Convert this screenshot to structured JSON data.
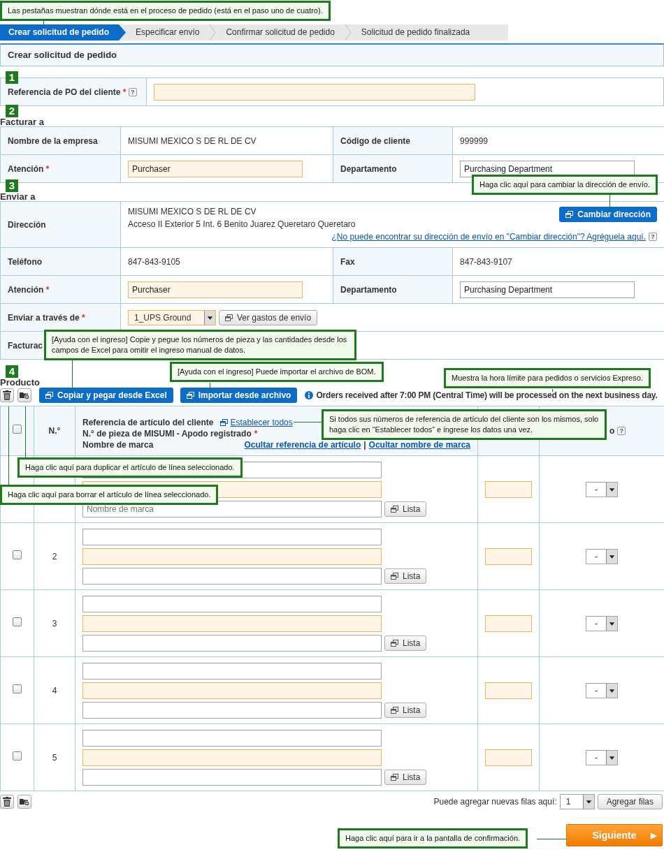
{
  "callouts": [
    {
      "text": "Las pestañas muestran dónde está en el proceso de pedido (está en el paso uno de cuatro)."
    },
    {
      "text": "Haga clic aquí para cambiar la dirección de envío."
    },
    {
      "text": "[Ayuda con el ingreso] Copie y pegue los números de pieza y las cantidades desde los campos de Excel para omitir el ingreso manual de datos."
    },
    {
      "text": "[Ayuda con el ingreso] Puede importar el archivo de BOM."
    },
    {
      "text": "Muestra la hora límite para pedidos o servicios Expreso."
    },
    {
      "text": "Si todos sus números de referencia de artículo del cliente son los mismos, solo haga clic en “Establecer todos” e ingrese los datos una vez."
    },
    {
      "text": "Haga clic aquí para duplicar el artículo de línea seleccionado."
    },
    {
      "text": "Haga clic aquí para borrar el artículo de línea seleccionado."
    },
    {
      "text": "Haga clic aquí para ir a la pantalla de confirmación."
    }
  ],
  "steps": [
    {
      "label": "Crear solicitud de pedido",
      "selected": true
    },
    {
      "label": "Especificar envío",
      "selected": false
    },
    {
      "label": "Confirmar solicitud de pedido",
      "selected": false
    },
    {
      "label": "Solicitud de pedido finalizada",
      "selected": false
    }
  ],
  "page_title": "Crear solicitud de pedido",
  "po_section": {
    "badge": "1",
    "label": "Referencia de PO del cliente",
    "mark": "*",
    "help": "?",
    "required": true
  },
  "bill_to": {
    "badge": "2",
    "title": "Facturar a",
    "rows": [
      [
        {
          "kind": "label",
          "text": "Nombre de la empresa"
        },
        {
          "kind": "text",
          "text": "MISUMI MEXICO S DE RL DE CV"
        },
        {
          "kind": "label",
          "text": "Código de cliente"
        },
        {
          "kind": "text",
          "text": "999999"
        }
      ],
      [
        {
          "kind": "label",
          "text": "Atención",
          "mark": "*"
        },
        {
          "kind": "field",
          "value": "Purchaser",
          "required": true
        },
        {
          "kind": "label",
          "text": "Departamento"
        },
        {
          "kind": "field",
          "value": "Purchasing Department",
          "required": false
        }
      ]
    ]
  },
  "ship_to": {
    "badge": "3",
    "title": "Enviar a",
    "rows": [
      [
        {
          "kind": "label",
          "text": "Dirección"
        },
        {
          "kind": "address",
          "lines": [
            "MISUMI MEXICO S DE RL DE CV",
            "Acceso II Exterior 5 Int. 6 Benito Juarez Queretaro Queretaro"
          ],
          "colspan": 3,
          "button": "Cambiar dirección",
          "link": "¿No puede encontrar su dirección de envío en \"Cambiar dirección\"? Agréguela aquí.",
          "help": "?"
        }
      ],
      [
        {
          "kind": "label",
          "text": "Teléfono"
        },
        {
          "kind": "text",
          "text": "847-843-9105"
        },
        {
          "kind": "label",
          "text": "Fax"
        },
        {
          "kind": "text",
          "text": "847-843-9107"
        }
      ],
      [
        {
          "kind": "label",
          "text": "Atención",
          "mark": "*"
        },
        {
          "kind": "field",
          "value": "Purchaser",
          "required": true
        },
        {
          "kind": "label",
          "text": "Departamento"
        },
        {
          "kind": "field",
          "value": "Purchasing Department",
          "required": false
        }
      ],
      [
        {
          "kind": "label",
          "text": "Enviar a través de",
          "mark": "*"
        },
        {
          "kind": "select",
          "colspan": 3,
          "value": "1_UPS Ground",
          "required": true,
          "button": "Ver gastos de envío"
        }
      ],
      [
        {
          "kind": "label",
          "text": "Facturac"
        },
        {
          "kind": "blank",
          "colspan": 3
        }
      ]
    ]
  },
  "product": {
    "badge": "4",
    "title": "Producto",
    "buttons": [
      "Copiar y pegar desde Excel",
      "Importar desde archivo"
    ],
    "notice": "Orders received after 7:00 PM (Central Time) will be processed on the next business day.",
    "header": {
      "checked": false,
      "number": "N.°",
      "item_lines": [
        {
          "text": "Referencia de artículo del cliente"
        },
        {
          "text": "N.° de pieza de MISUMI - Apodo registrado",
          "mark": "*"
        },
        {
          "text": "Nombre de marca"
        }
      ],
      "set_all": "Establecer todos",
      "hide_links": [
        "Ocultar referencia de artículo",
        "Ocultar nombre de marca"
      ],
      "link_separator": "|",
      "column_4": "o",
      "help": "?"
    },
    "rows": [
      {
        "brand_placeholder": "Nombre de marca",
        "list_button": "Lista",
        "select": "-"
      },
      {
        "checked": false,
        "number": "2",
        "list_button": "Lista",
        "select": "-"
      },
      {
        "checked": false,
        "number": "3",
        "list_button": "Lista",
        "select": "-"
      },
      {
        "checked": false,
        "number": "4",
        "list_button": "Lista",
        "select": "-"
      },
      {
        "checked": false,
        "number": "5",
        "list_button": "Lista",
        "select": "-"
      }
    ],
    "add_rows": {
      "label": "Puede agregar nuevas filas aquí:",
      "value": "1",
      "button": "Agregar filas"
    }
  },
  "next_button": {
    "label": "Siguiente",
    "arrow": "▶"
  }
}
